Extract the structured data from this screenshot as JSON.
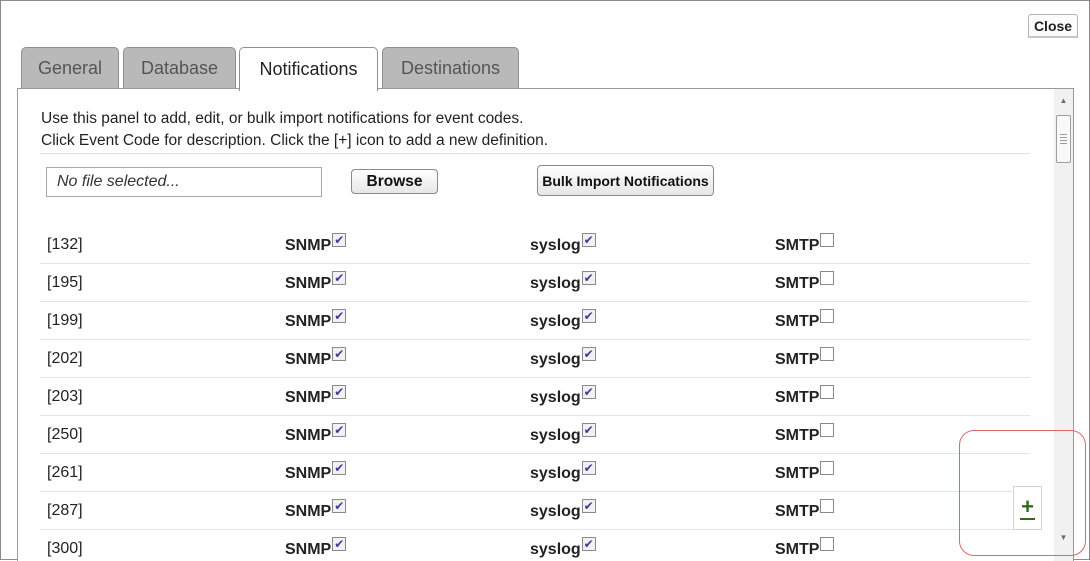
{
  "dialog": {
    "close_label": "Close",
    "tabs": [
      {
        "label": "General",
        "active": false
      },
      {
        "label": "Database",
        "active": false
      },
      {
        "label": "Notifications",
        "active": true
      },
      {
        "label": "Destinations",
        "active": false
      }
    ]
  },
  "notifications": {
    "instructions_line1": "Use this panel to add, edit, or bulk import notifications for event codes.",
    "instructions_line2": "Click Event Code for description. Click the [+] icon to add a new definition.",
    "file_field_value": "No file selected...",
    "browse_label": "Browse",
    "bulk_import_label": "Bulk Import Notifications",
    "add_icon_glyph": "+",
    "options": [
      "SNMP",
      "syslog",
      "SMTP"
    ],
    "rows": [
      {
        "code": "[132]",
        "snmp": true,
        "syslog": true,
        "smtp": false
      },
      {
        "code": "[195]",
        "snmp": true,
        "syslog": true,
        "smtp": false
      },
      {
        "code": "[199]",
        "snmp": true,
        "syslog": true,
        "smtp": false
      },
      {
        "code": "[202]",
        "snmp": true,
        "syslog": true,
        "smtp": false
      },
      {
        "code": "[203]",
        "snmp": true,
        "syslog": true,
        "smtp": false
      },
      {
        "code": "[250]",
        "snmp": true,
        "syslog": true,
        "smtp": false
      },
      {
        "code": "[261]",
        "snmp": true,
        "syslog": true,
        "smtp": false
      },
      {
        "code": "[287]",
        "snmp": true,
        "syslog": true,
        "smtp": false
      },
      {
        "code": "[300]",
        "snmp": true,
        "syslog": true,
        "smtp": false
      }
    ]
  },
  "icons": {
    "checkbox_checked": "check-icon",
    "scroll_up": "arrow-up-icon",
    "scroll_down": "arrow-down-icon",
    "add": "plus-icon"
  },
  "colors": {
    "tab_inactive": "#b9b9b9",
    "add_icon": "#2f6b1c",
    "highlight": "#e06767"
  }
}
